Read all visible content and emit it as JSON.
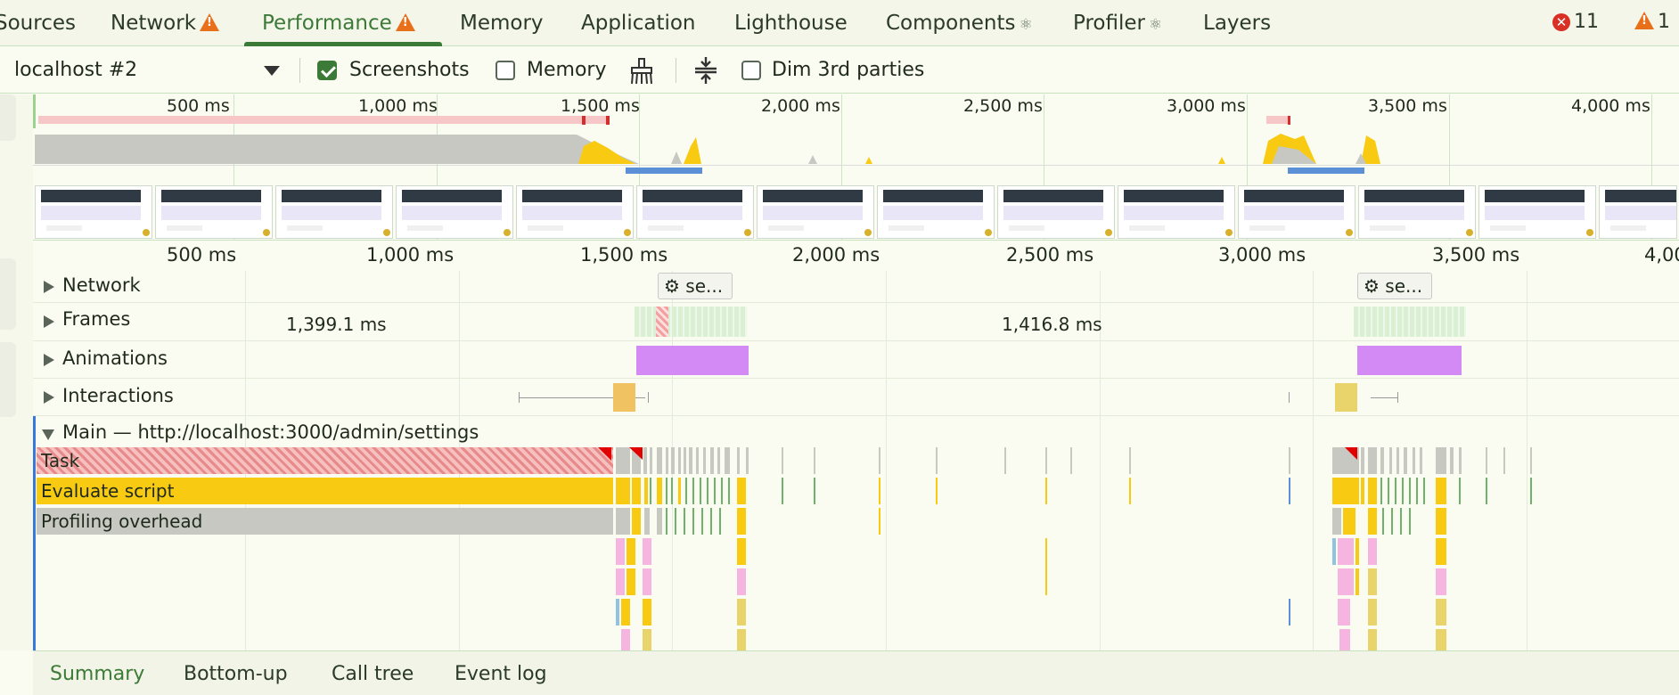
{
  "tabs": [
    {
      "label": "Sources",
      "warning": false,
      "react": false
    },
    {
      "label": "Network",
      "warning": true,
      "react": false
    },
    {
      "label": "Performance",
      "warning": true,
      "react": false,
      "active": true
    },
    {
      "label": "Memory",
      "warning": false,
      "react": false
    },
    {
      "label": "Application",
      "warning": false,
      "react": false
    },
    {
      "label": "Lighthouse",
      "warning": false,
      "react": false
    },
    {
      "label": "Components",
      "warning": false,
      "react": true
    },
    {
      "label": "Profiler",
      "warning": false,
      "react": true
    },
    {
      "label": "Layers",
      "warning": false,
      "react": false
    }
  ],
  "status": {
    "errors": "11",
    "warnings": "1"
  },
  "toolbar": {
    "target": "localhost #2",
    "screenshots_label": "Screenshots",
    "screenshots_checked": true,
    "memory_label": "Memory",
    "memory_checked": false,
    "dim_label": "Dim 3rd parties",
    "dim_checked": false
  },
  "overview_ticks": [
    "500 ms",
    "1,000 ms",
    "1,500 ms",
    "2,000 ms",
    "2,500 ms",
    "3,000 ms",
    "3,500 ms",
    "4,000 ms"
  ],
  "ruler_ticks": [
    "500 ms",
    "1,000 ms",
    "1,500 ms",
    "2,000 ms",
    "2,500 ms",
    "3,000 ms",
    "3,500 ms",
    "4,00"
  ],
  "tracks": {
    "network": "Network",
    "frames": "Frames",
    "animations": "Animations",
    "interactions": "Interactions",
    "main": "Main — http://localhost:3000/admin/settings"
  },
  "network_pills": [
    "se...",
    "se..."
  ],
  "frame_durations": [
    "1,399.1 ms",
    "1,416.8 ms"
  ],
  "flame": {
    "task": "Task",
    "evaluate": "Evaluate script",
    "overhead": "Profiling overhead"
  },
  "bottom_tabs": [
    "Summary",
    "Bottom-up",
    "Call tree",
    "Event log"
  ],
  "colors": {
    "accent": "#3c7a37",
    "script": "#f8cb12",
    "overhead": "#c7c8c2",
    "animation": "#d38af5",
    "paint": "#f5b5e0",
    "network_bar": "#5b8fd6",
    "long_task": "#d93025"
  }
}
